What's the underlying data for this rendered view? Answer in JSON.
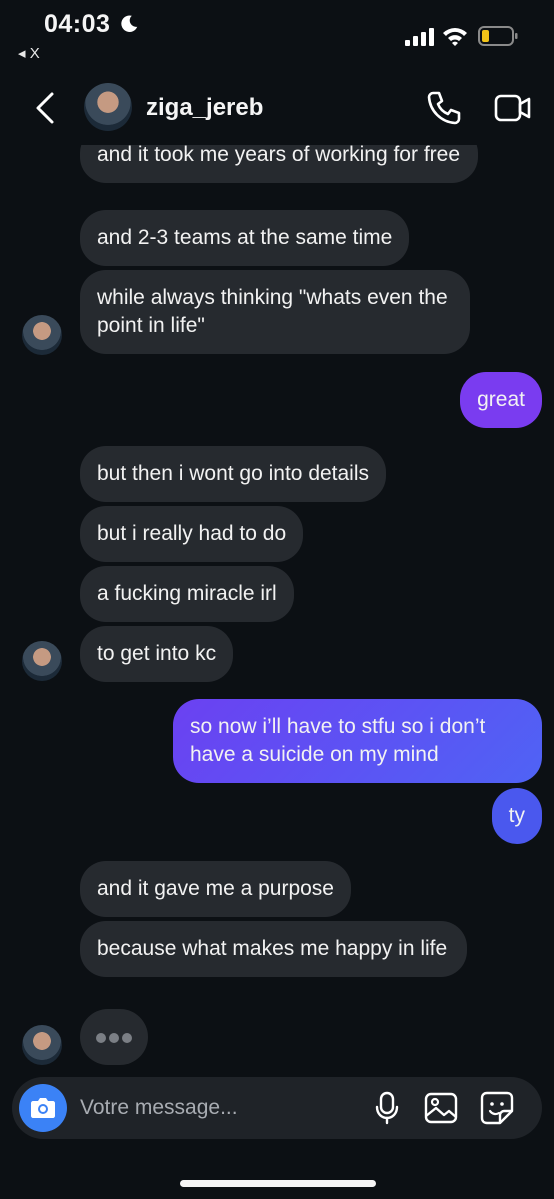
{
  "status_bar": {
    "time": "04:03",
    "back_app": "◂ X"
  },
  "header": {
    "username": "ziga_jereb"
  },
  "messages": [
    {
      "from": "them",
      "text": "and it took me years of working for free"
    },
    {
      "from": "them",
      "text": "and 2-3 teams at the same time"
    },
    {
      "from": "them",
      "text": "while always thinking \"whats even the point in life\""
    },
    {
      "from": "me",
      "text": "great"
    },
    {
      "from": "them",
      "text": "but then i wont go into details"
    },
    {
      "from": "them",
      "text": "but i really had to do"
    },
    {
      "from": "them",
      "text": "a fucking miracle irl"
    },
    {
      "from": "them",
      "text": "to get into kc"
    },
    {
      "from": "me",
      "text": "so now i’ll have to stfu so i don’t have a suicide on my mind"
    },
    {
      "from": "me",
      "text": "ty"
    },
    {
      "from": "them",
      "text": "and it gave me a purpose"
    },
    {
      "from": "them",
      "text": "because what makes me happy in life"
    }
  ],
  "composer": {
    "placeholder": "Votre message..."
  },
  "colors": {
    "background": "#0c1014",
    "incoming_bubble": "#262a2f",
    "outgoing_purple": "#7a3cf0",
    "outgoing_blue": "#4a58ee",
    "camera_button": "#3b82f6"
  },
  "icons": [
    "moon-icon",
    "signal-icon",
    "wifi-icon",
    "battery-icon",
    "back-arrow-icon",
    "phone-icon",
    "video-camera-icon",
    "camera-icon",
    "microphone-icon",
    "gallery-icon",
    "sticker-icon"
  ]
}
